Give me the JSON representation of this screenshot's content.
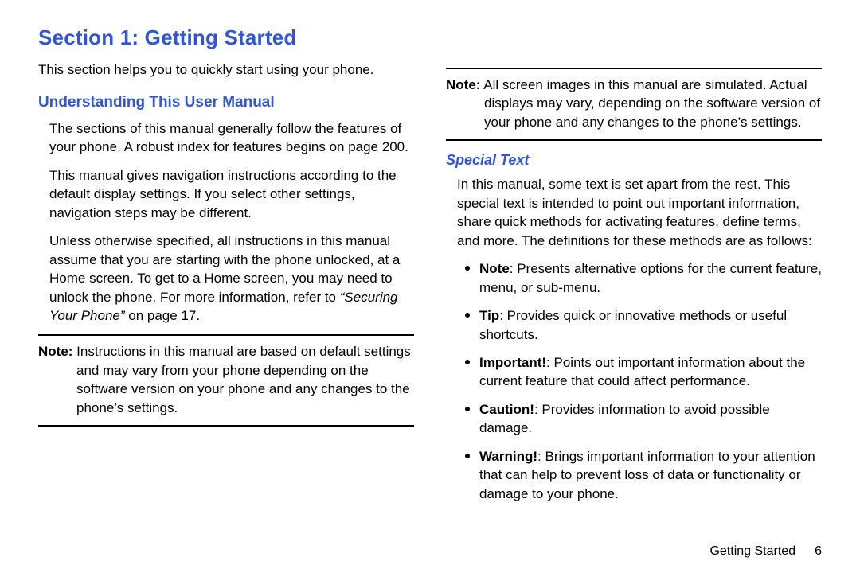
{
  "section_title": "Section 1: Getting Started",
  "intro": "This section helps you to quickly start using your phone.",
  "left": {
    "heading": "Understanding This User Manual",
    "p1": "The sections of this manual generally follow the features of your phone. A robust index for features begins on page 200.",
    "p2": "This manual gives navigation instructions according to the default display settings. If you select other settings, navigation steps may be different.",
    "p3_pre": "Unless otherwise specified, all instructions in this manual assume that you are starting with the phone unlocked, at a Home screen. To get to a Home screen, you may need to unlock the phone. For more information, refer to ",
    "p3_ref": "“Securing Your Phone”",
    "p3_post": " on page 17.",
    "note1_label": "Note:",
    "note1_body": " Instructions in this manual are based on default settings and may vary from your phone depending on the software version on your phone and any changes to the phone’s settings."
  },
  "right": {
    "note2_label": "Note:",
    "note2_body": " All screen images in this manual are simulated. Actual displays may vary, depending on the software version of your phone and any changes to the phone’s settings.",
    "heading": "Special Text",
    "intro": "In this manual, some text is set apart from the rest. This special text is intended to point out important information, share quick methods for activating features, define terms, and more. The definitions for these methods are as follows:",
    "defs": [
      {
        "term": "Note",
        "desc": ": Presents alternative options for the current feature, menu, or sub-menu."
      },
      {
        "term": "Tip",
        "desc": ": Provides quick or innovative methods or useful shortcuts."
      },
      {
        "term": "Important!",
        "desc": ": Points out important information about the current feature that could affect performance."
      },
      {
        "term": "Caution!",
        "desc": ": Provides information to avoid possible damage."
      },
      {
        "term": "Warning!",
        "desc": ": Brings important information to your attention that can help to prevent loss of data or functionality or damage to your phone."
      }
    ]
  },
  "footer": {
    "text": "Getting Started",
    "page": "6"
  }
}
